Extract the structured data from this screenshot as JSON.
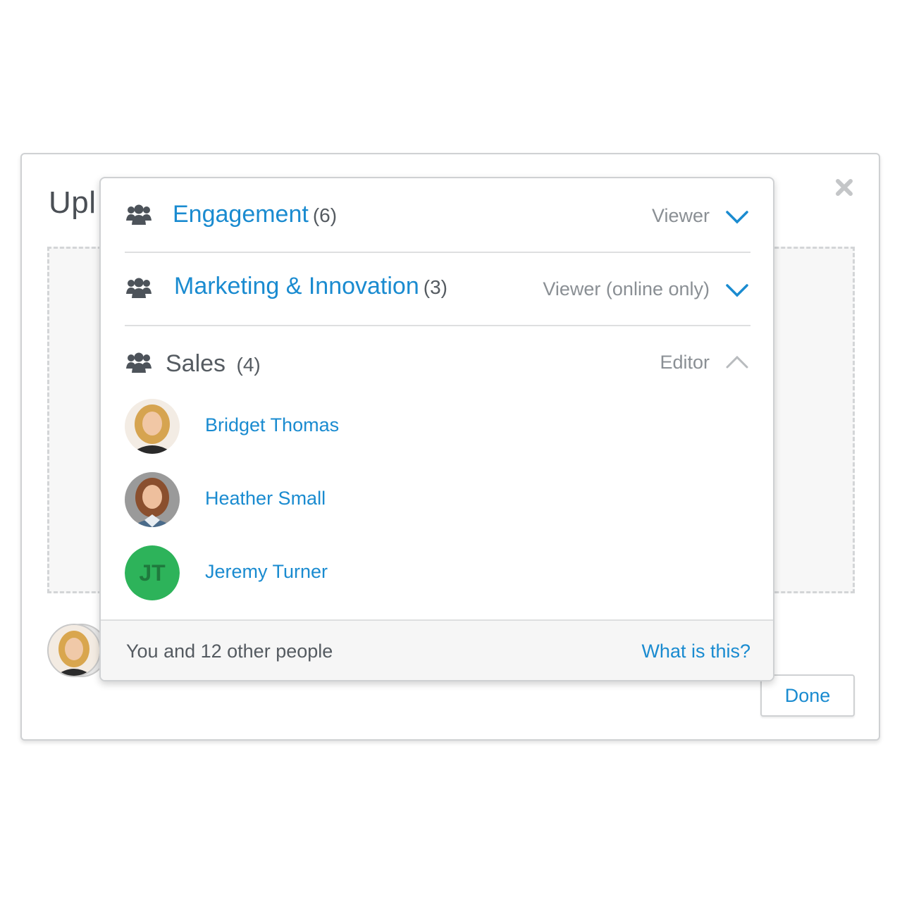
{
  "dialog": {
    "title": "Upl",
    "close_icon": "close-icon",
    "done_label": "Done"
  },
  "groups": [
    {
      "name": "Engagement",
      "count": "(6)",
      "role": "Viewer",
      "expanded": false
    },
    {
      "name": "Marketing & Innovation",
      "count": "(3)",
      "role": "Viewer (online only)",
      "expanded": false
    },
    {
      "name": "Sales",
      "count": "(4)",
      "role": "Editor",
      "expanded": true
    }
  ],
  "members": [
    {
      "name": "Bridget Thomas",
      "avatar": "photo"
    },
    {
      "name": "Heather Small",
      "avatar": "photo"
    },
    {
      "name": "Jeremy Turner",
      "avatar": "initials",
      "initials": "JT"
    }
  ],
  "footer": {
    "summary": "You and 12 other people",
    "help_link": "What is this?"
  },
  "colors": {
    "accent": "#1a8bd0",
    "initials_bg": "#2db35a",
    "text_dark": "#555b61",
    "text_muted": "#8a8f94"
  }
}
